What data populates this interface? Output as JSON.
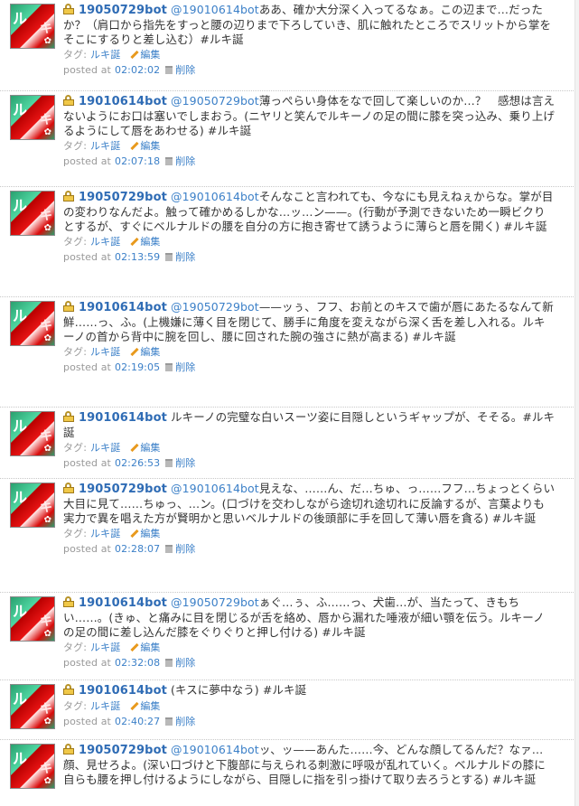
{
  "labels": {
    "tag_label": "タグ:",
    "edit": "編集",
    "posted_at": "posted at",
    "delete": "削除"
  },
  "entries": [
    {
      "author": "19050729bot",
      "mention": "@19010614bot",
      "text": "ああ、確か大分深く入ってるなぁ。この辺まで…だったか？（肩口から指先をすっと腰の辺りまで下ろしていき、肌に触れたところでスリットから掌をそこにするりと差し込む）#ルキ誕",
      "tag": "ルキ誕",
      "time": "02:02:02"
    },
    {
      "author": "19010614bot",
      "mention": "@19050729bot",
      "text": "薄っぺらい身体をなで回して楽しいのか…？　感想は言えないようにお口は塞いでしまおう。(ニヤリと笑んでルキーノの足の間に膝を突っ込み、乗り上げるようにして唇をあわせる) #ルキ誕",
      "tag": "ルキ誕",
      "time": "02:07:18"
    },
    {
      "author": "19050729bot",
      "mention": "@19010614bot",
      "text": "そんなこと言われても、今なにも見えねぇからな。掌が目の変わりなんだよ。触って確かめるしかな…ッ…ン——。(行動が予測できないため一瞬ビクりとするが、すぐにベルナルドの腰を自分の方に抱き寄せて誘うように薄らと唇を開く) #ルキ誕",
      "tag": "ルキ誕",
      "time": "02:13:59"
    },
    {
      "author": "19010614bot",
      "mention": "@19050729bot",
      "text": "——ッぅ、フフ、お前とのキスで歯が唇にあたるなんて新鮮……っ、ふ。(上機嫌に薄く目を閉じて、勝手に角度を変えながら深く舌を差し入れる。ルキーノの首から背中に腕を回し、腰に回された腕の強さに熱が高まる) #ルキ誕",
      "tag": "ルキ誕",
      "time": "02:19:05"
    },
    {
      "author": "19010614bot",
      "mention": "",
      "text": "ルキーノの完璧な白いスーツ姿に目隠しというギャップが、そそる。#ルキ誕",
      "tag": "ルキ誕",
      "time": "02:26:53"
    },
    {
      "author": "19050729bot",
      "mention": "@19010614bot",
      "text": "見えな、……ん、だ…ちゅ、っ……フフ…ちょっとくらい大目に見て……ちゅっ、…ン。(口づけを交わしながら途切れ途切れに反論するが、言葉よりも実力で異を唱えた方が賢明かと思いベルナルドの後頭部に手を回して薄い唇を貪る) #ルキ誕",
      "tag": "ルキ誕",
      "time": "02:28:07"
    },
    {
      "author": "19010614bot",
      "mention": "@19050729bot",
      "text": "ぁぐ…ぅ、ふ……っ、犬歯…が、当たって、きもちい……。(きゅ、と痛みに目を閉じるが舌を絡め、唇から漏れた唾液が細い顎を伝う。ルキーノの足の間に差し込んだ膝をぐりぐりと押し付ける) #ルキ誕",
      "tag": "ルキ誕",
      "time": "02:32:08"
    },
    {
      "author": "19010614bot",
      "mention": "",
      "text": "(キスに夢中なう) #ルキ誕",
      "tag": "ルキ誕",
      "time": "02:40:27"
    },
    {
      "author": "19050729bot",
      "mention": "@19010614bot",
      "text": "ッ、ッ——あんた……今、どんな顔してるんだ？なァ…顔、見せろよ。(深い口づけと下腹部に与えられる刺激に呼吸が乱れていく。ベルナルドの膝に自らも腰を押し付けるようにしながら、目隠しに指を引っ掛けて取り去ろうとする) #ルキ誕",
      "tag": "",
      "time": ""
    }
  ]
}
